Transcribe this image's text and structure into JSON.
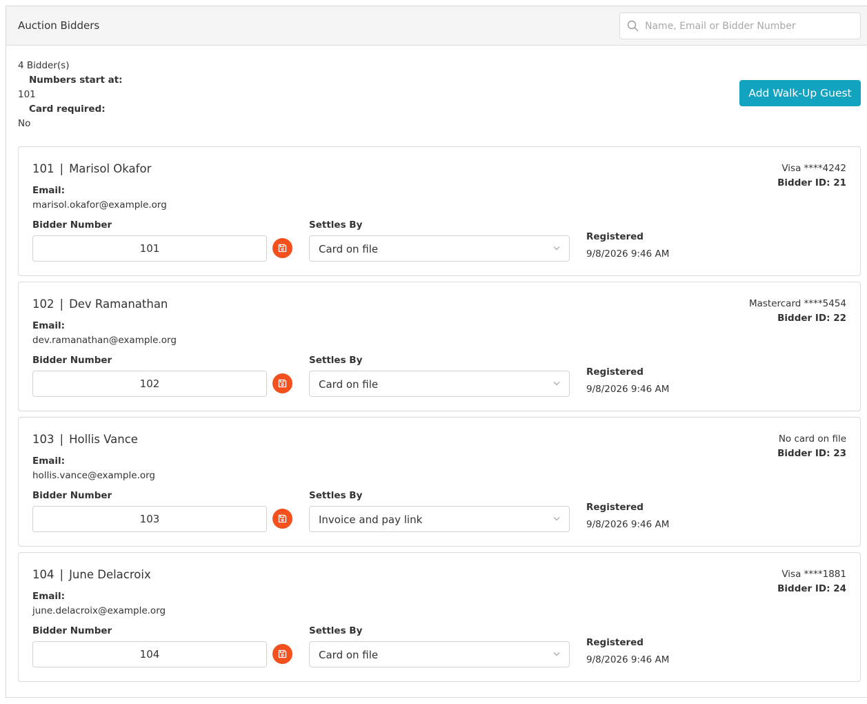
{
  "header": {
    "title": "Auction Bidders",
    "search_placeholder": "Name, Email or Bidder Number",
    "search_value": ""
  },
  "summary": {
    "count_text": "4 Bidder(s)",
    "numbers_start_label": "Numbers start at:",
    "numbers_start_value": "101",
    "card_required_label": "Card required:",
    "card_required_value": "No"
  },
  "add_button_label": "Add Walk-Up Guest",
  "labels": {
    "email": "Email:",
    "bidder_number": "Bidder Number",
    "settles_by": "Settles By",
    "registered": "Registered",
    "name_separator": "|"
  },
  "bidders": [
    {
      "number": "101",
      "name": "Marisol Okafor",
      "email": "marisol.okafor@example.org",
      "card": "Visa ****4242",
      "bidder_id": "Bidder ID: 21",
      "bidder_number_value": "101",
      "settles_by": "Card on file",
      "registered": "9/8/2026 9:46 AM"
    },
    {
      "number": "102",
      "name": "Dev Ramanathan",
      "email": "dev.ramanathan@example.org",
      "card": "Mastercard ****5454",
      "bidder_id": "Bidder ID: 22",
      "bidder_number_value": "102",
      "settles_by": "Card on file",
      "registered": "9/8/2026 9:46 AM"
    },
    {
      "number": "103",
      "name": "Hollis Vance",
      "email": "hollis.vance@example.org",
      "card": "No card on file",
      "bidder_id": "Bidder ID: 23",
      "bidder_number_value": "103",
      "settles_by": "Invoice and pay link",
      "registered": "9/8/2026 9:46 AM"
    },
    {
      "number": "104",
      "name": "June Delacroix",
      "email": "june.delacroix@example.org",
      "card": "Visa ****1881",
      "bidder_id": "Bidder ID: 24",
      "bidder_number_value": "104",
      "settles_by": "Card on file",
      "registered": "9/8/2026 9:46 AM"
    }
  ],
  "colors": {
    "accent": "#11a3c0",
    "save_button": "#f4511e",
    "header_bg": "#f5f5f5",
    "border": "#dcdcdc"
  },
  "icons": {
    "search": "search-icon",
    "save": "save-icon",
    "dropdown": "chevron-down-icon"
  }
}
